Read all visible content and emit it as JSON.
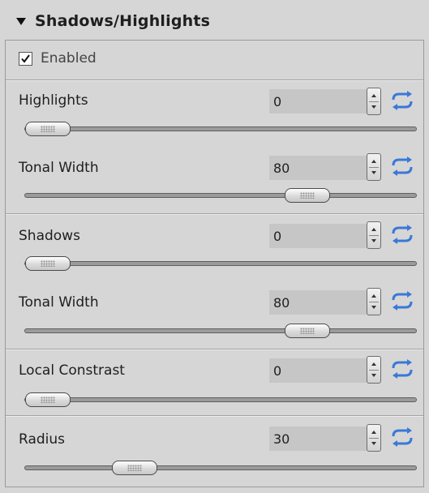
{
  "panel": {
    "title": "Shadows/Highlights",
    "collapse_icon": "triangle-down-icon",
    "enabled": {
      "label": "Enabled",
      "checked": true
    }
  },
  "rows": [
    {
      "key": "highlights",
      "label": "Highlights",
      "value": "0",
      "slider_fraction": 0.0
    },
    {
      "key": "highlights-tonal",
      "label": "Tonal Width",
      "value": "80",
      "slider_fraction": 0.75
    },
    {
      "key": "shadows",
      "label": "Shadows",
      "value": "0",
      "slider_fraction": 0.0
    },
    {
      "key": "shadows-tonal",
      "label": "Tonal Width",
      "value": "80",
      "slider_fraction": 0.75
    },
    {
      "key": "local-contrast",
      "label": "Local Constrast",
      "value": "0",
      "slider_fraction": 0.0
    },
    {
      "key": "radius",
      "label": "Radius",
      "value": "30",
      "slider_fraction": 0.25
    }
  ],
  "icons": {
    "spinner": "up-down-spinner-icon",
    "reset": "reset-arrows-icon"
  },
  "colors": {
    "background": "#d6d6d6",
    "field": "#c6c6c6",
    "reset_icon": "#3a78d8"
  }
}
